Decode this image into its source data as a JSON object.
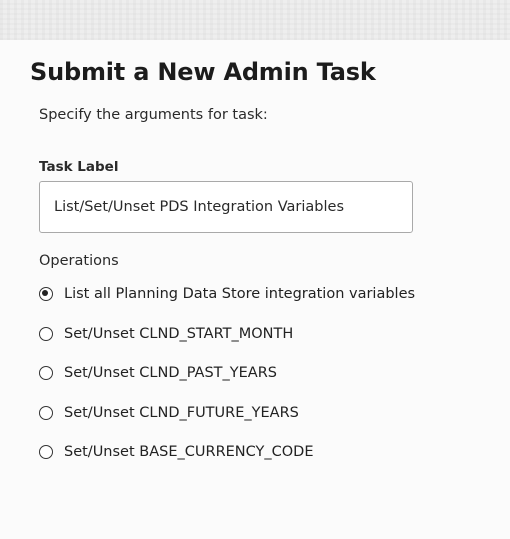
{
  "dialog": {
    "title": "Submit a New Admin Task",
    "subtitle": "Specify the arguments for task:"
  },
  "task_label": {
    "label": "Task Label",
    "value": "List/Set/Unset PDS Integration Variables"
  },
  "operations": {
    "label": "Operations",
    "selected_index": 0,
    "options": [
      {
        "label": "List all Planning Data Store integration variables",
        "checked": true
      },
      {
        "label": "Set/Unset CLND_START_MONTH",
        "checked": false
      },
      {
        "label": "Set/Unset CLND_PAST_YEARS",
        "checked": false
      },
      {
        "label": "Set/Unset CLND_FUTURE_YEARS",
        "checked": false
      },
      {
        "label": "Set/Unset BASE_CURRENCY_CODE",
        "checked": false
      }
    ]
  }
}
